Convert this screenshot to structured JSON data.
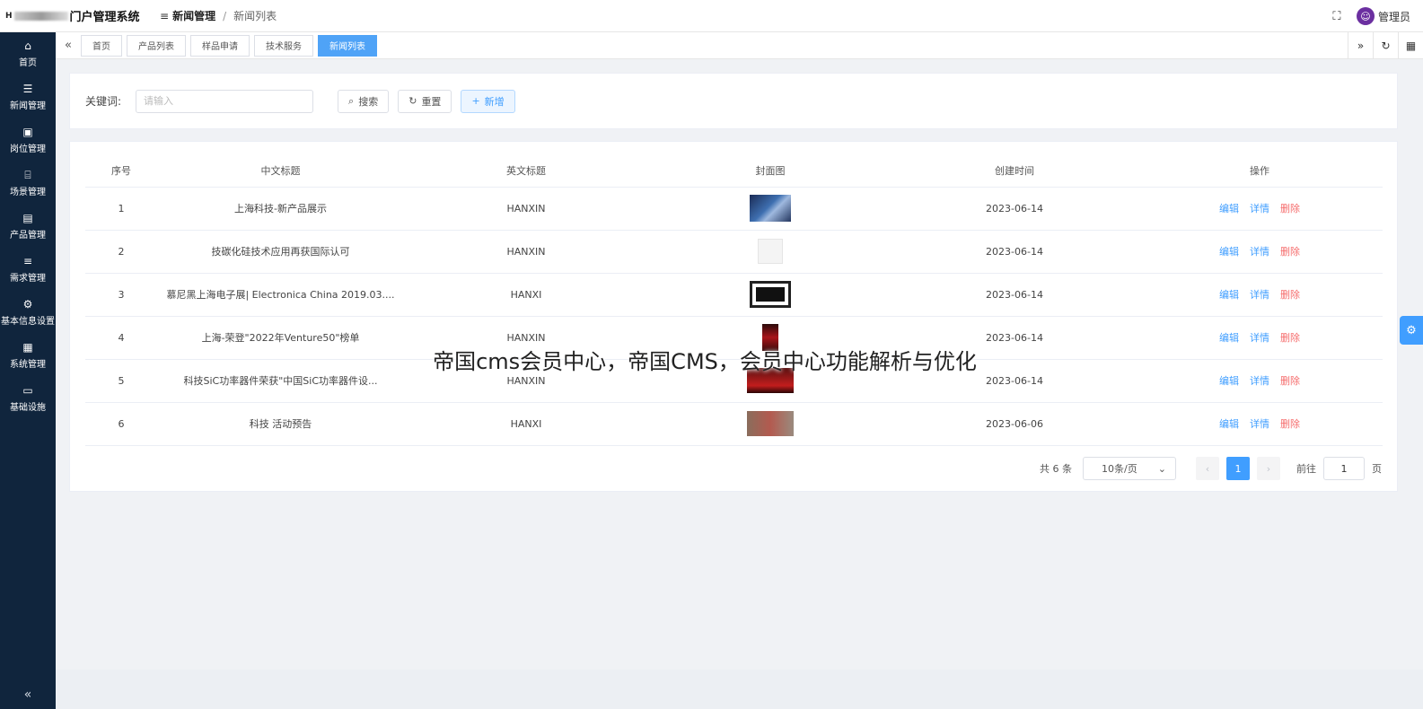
{
  "header": {
    "logo_text": "H",
    "title": "门户管理系统",
    "breadcrumb": [
      "新闻管理",
      "新闻列表"
    ],
    "user_name": "管理员"
  },
  "sidebar": {
    "items": [
      {
        "label": "首页",
        "icon": "home-icon"
      },
      {
        "label": "新闻管理",
        "icon": "news-icon"
      },
      {
        "label": "岗位管理",
        "icon": "badge-icon"
      },
      {
        "label": "场景管理",
        "icon": "bank-icon"
      },
      {
        "label": "产品管理",
        "icon": "box-icon"
      },
      {
        "label": "需求管理",
        "icon": "list-icon"
      },
      {
        "label": "基本信息设置",
        "icon": "settings-icon"
      },
      {
        "label": "系统管理",
        "icon": "briefcase-icon"
      },
      {
        "label": "基础设施",
        "icon": "monitor-icon"
      }
    ]
  },
  "tabs": [
    "首页",
    "产品列表",
    "样品申请",
    "技术服务",
    "新闻列表"
  ],
  "active_tab": "新闻列表",
  "search": {
    "label": "关键词:",
    "placeholder": "请输入",
    "search_btn": "搜索",
    "reset_btn": "重置",
    "add_btn": "新增"
  },
  "table": {
    "headers": [
      "序号",
      "中文标题",
      "英文标题",
      "封面图",
      "创建时间",
      "操作"
    ],
    "rows": [
      {
        "idx": "1",
        "zh": "上海科技-新产品展示",
        "en": "HANXIN",
        "date": "2023-06-14"
      },
      {
        "idx": "2",
        "zh": "技碳化硅技术应用再获国际认可",
        "en": "HANXIN",
        "date": "2023-06-14"
      },
      {
        "idx": "3",
        "zh": "慕尼黑上海电子展| Electronica China 2019.03....",
        "en": "HANXI",
        "date": "2023-06-14"
      },
      {
        "idx": "4",
        "zh": "上海-荣登\"2022年Venture50\"榜单",
        "en": "HANXIN",
        "date": "2023-06-14"
      },
      {
        "idx": "5",
        "zh": "科技SiC功率器件荣获\"中国SiC功率器件设...",
        "en": "HANXIN",
        "date": "2023-06-14"
      },
      {
        "idx": "6",
        "zh": "科技 活动预告",
        "en": "HANXI",
        "date": "2023-06-06"
      }
    ],
    "actions": {
      "edit": "编辑",
      "detail": "详情",
      "delete": "删除"
    }
  },
  "pagination": {
    "total": "共 6 条",
    "page_size": "10条/页",
    "current": "1",
    "goto_prefix": "前往",
    "goto_value": "1",
    "goto_suffix": "页"
  },
  "overlay_title": "帝国cms会员中心，帝国CMS，会员中心功能解析与优化"
}
